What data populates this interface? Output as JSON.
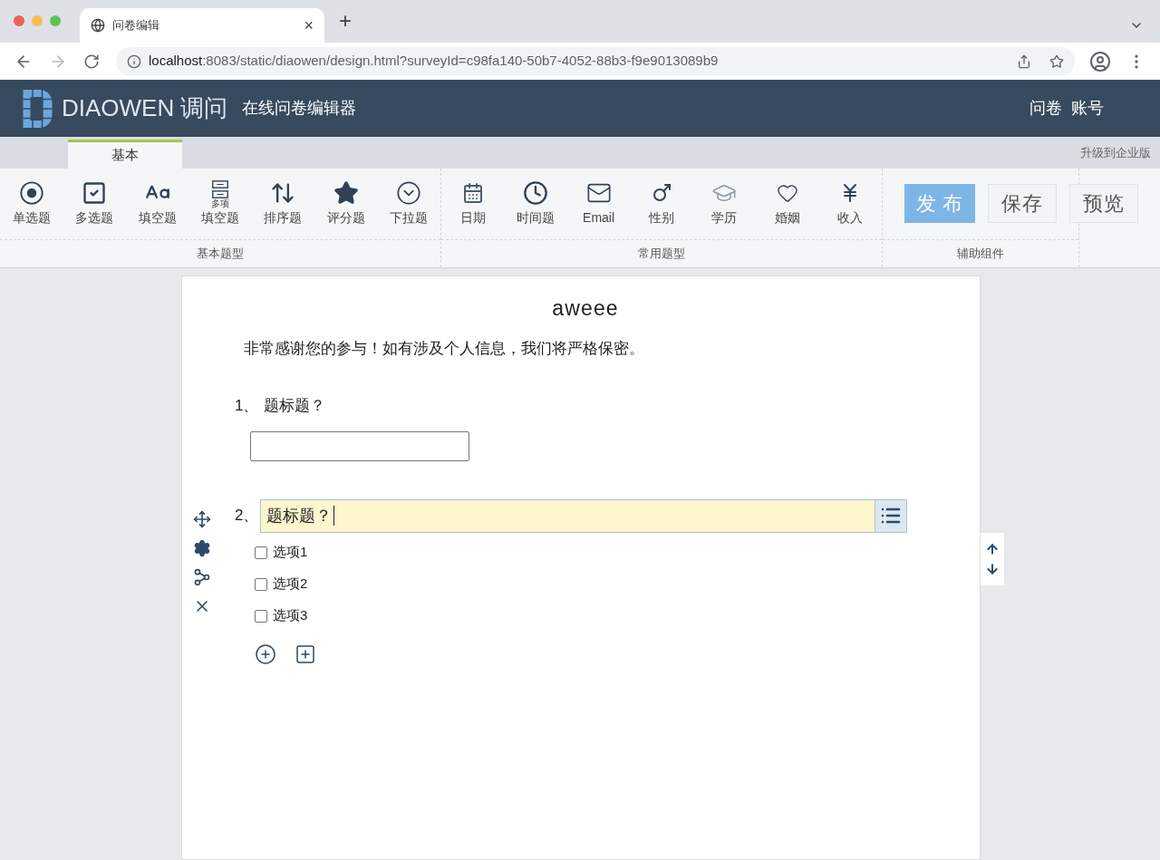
{
  "browser": {
    "tab_title": "问卷编辑",
    "tab_close": "×",
    "new_tab": "+",
    "url_host": "localhost",
    "url_rest": ":8083/static/diaowen/design.html?surveyId=c98fa140-50b7-4052-88b3-f9e9013089b9"
  },
  "header": {
    "logo_word": "DIAOWEN",
    "logo_cn": "调问",
    "subtitle": "在线问卷编辑器",
    "nav": [
      "问卷",
      "账号"
    ]
  },
  "ribbon_tabs": [
    {
      "label": "基本",
      "selected": true
    }
  ],
  "upgrade_link": "升级到企业版",
  "tool_groups": [
    {
      "label": "基本题型",
      "tools": [
        {
          "kind": "radio",
          "label": "单选题"
        },
        {
          "kind": "checkbox",
          "label": "多选题"
        },
        {
          "kind": "text",
          "label": "填空题"
        },
        {
          "kind": "multitext",
          "label": "填空题",
          "note": "多项"
        },
        {
          "kind": "sort",
          "label": "排序题"
        },
        {
          "kind": "star",
          "label": "评分题"
        },
        {
          "kind": "dropdown",
          "label": "下拉题"
        }
      ]
    },
    {
      "label": "常用题型",
      "tools": [
        {
          "kind": "date",
          "label": "日期"
        },
        {
          "kind": "time",
          "label": "时间题"
        },
        {
          "kind": "email",
          "label": "Email"
        },
        {
          "kind": "gender",
          "label": "性别"
        },
        {
          "kind": "education",
          "label": "学历"
        },
        {
          "kind": "marriage",
          "label": "婚姻"
        },
        {
          "kind": "income",
          "label": "收入"
        }
      ]
    },
    {
      "label": "辅助组件"
    }
  ],
  "actions": [
    {
      "kind": "primary",
      "label": "发 布"
    },
    {
      "kind": "default",
      "label": "保存"
    },
    {
      "kind": "default",
      "label": "预览"
    }
  ],
  "survey": {
    "title": "aweee",
    "intro": "非常感谢您的参与！如有涉及个人信息，我们将严格保密。",
    "questions": [
      {
        "kind": "text",
        "number": "1、",
        "title": "题标题？",
        "editing": false
      },
      {
        "kind": "checkbox",
        "number": "2、",
        "title": "题标题？",
        "editing": true,
        "options": [
          {
            "label": "选项1",
            "checked": false
          },
          {
            "label": "选项2",
            "checked": false
          },
          {
            "label": "选项3",
            "checked": false
          }
        ]
      }
    ]
  }
}
